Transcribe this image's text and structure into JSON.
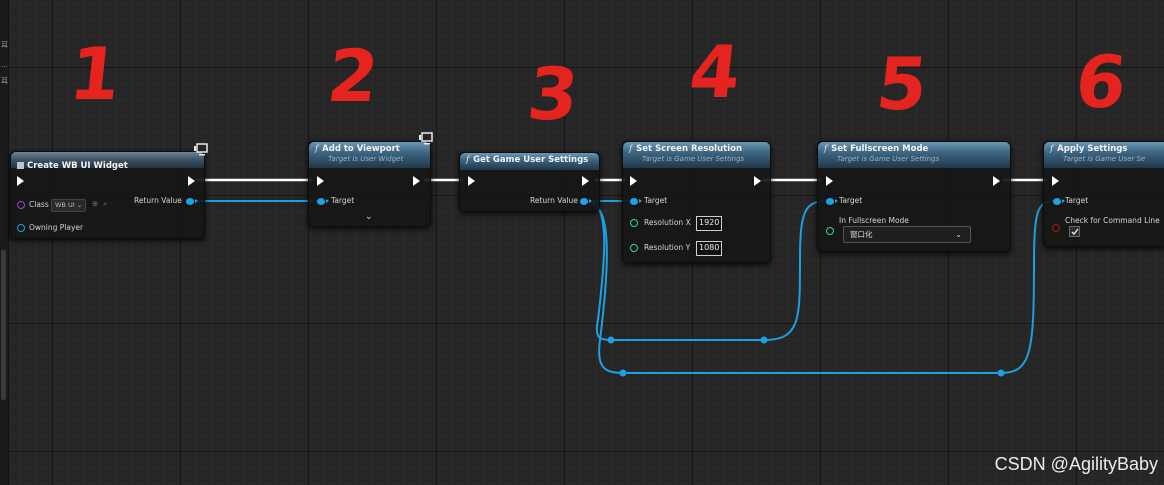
{
  "left_strip": {
    "marks": [
      "耳",
      "…",
      "耳"
    ]
  },
  "annotations": [
    "1",
    "2",
    "3",
    "4",
    "5",
    "6"
  ],
  "nodes": {
    "create_widget": {
      "title": "Create WB UI Widget",
      "class_label": "Class",
      "class_value": "WB UI",
      "owning_player_label": "Owning Player",
      "return_label": "Return Value"
    },
    "add_viewport": {
      "title": "Add to Viewport",
      "subtitle": "Target is User Widget",
      "target_label": "Target"
    },
    "get_settings": {
      "title": "Get Game User Settings",
      "return_label": "Return Value"
    },
    "set_resolution": {
      "title": "Set Screen Resolution",
      "subtitle": "Target is Game User Settings",
      "target_label": "Target",
      "res_x_label": "Resolution X",
      "res_x_value": "1920",
      "res_y_label": "Resolution Y",
      "res_y_value": "1080"
    },
    "set_fullscreen": {
      "title": "Set Fullscreen Mode",
      "subtitle": "Target is Game User Settings",
      "target_label": "Target",
      "mode_label": "In Fullscreen Mode",
      "mode_value": "窗口化"
    },
    "apply_settings": {
      "title": "Apply Settings",
      "subtitle": "Target is Game User Se",
      "target_label": "Target",
      "check_label": "Check for Command Line"
    }
  },
  "watermark": "CSDN @AgilityBaby",
  "colors": {
    "object_pin": "#1ea2e6",
    "class_pin": "#9a45d8",
    "int_pin": "#30d5a0",
    "bool_pin": "#b01818",
    "annotation": "#e52420",
    "exec_wire": "#ffffff"
  }
}
